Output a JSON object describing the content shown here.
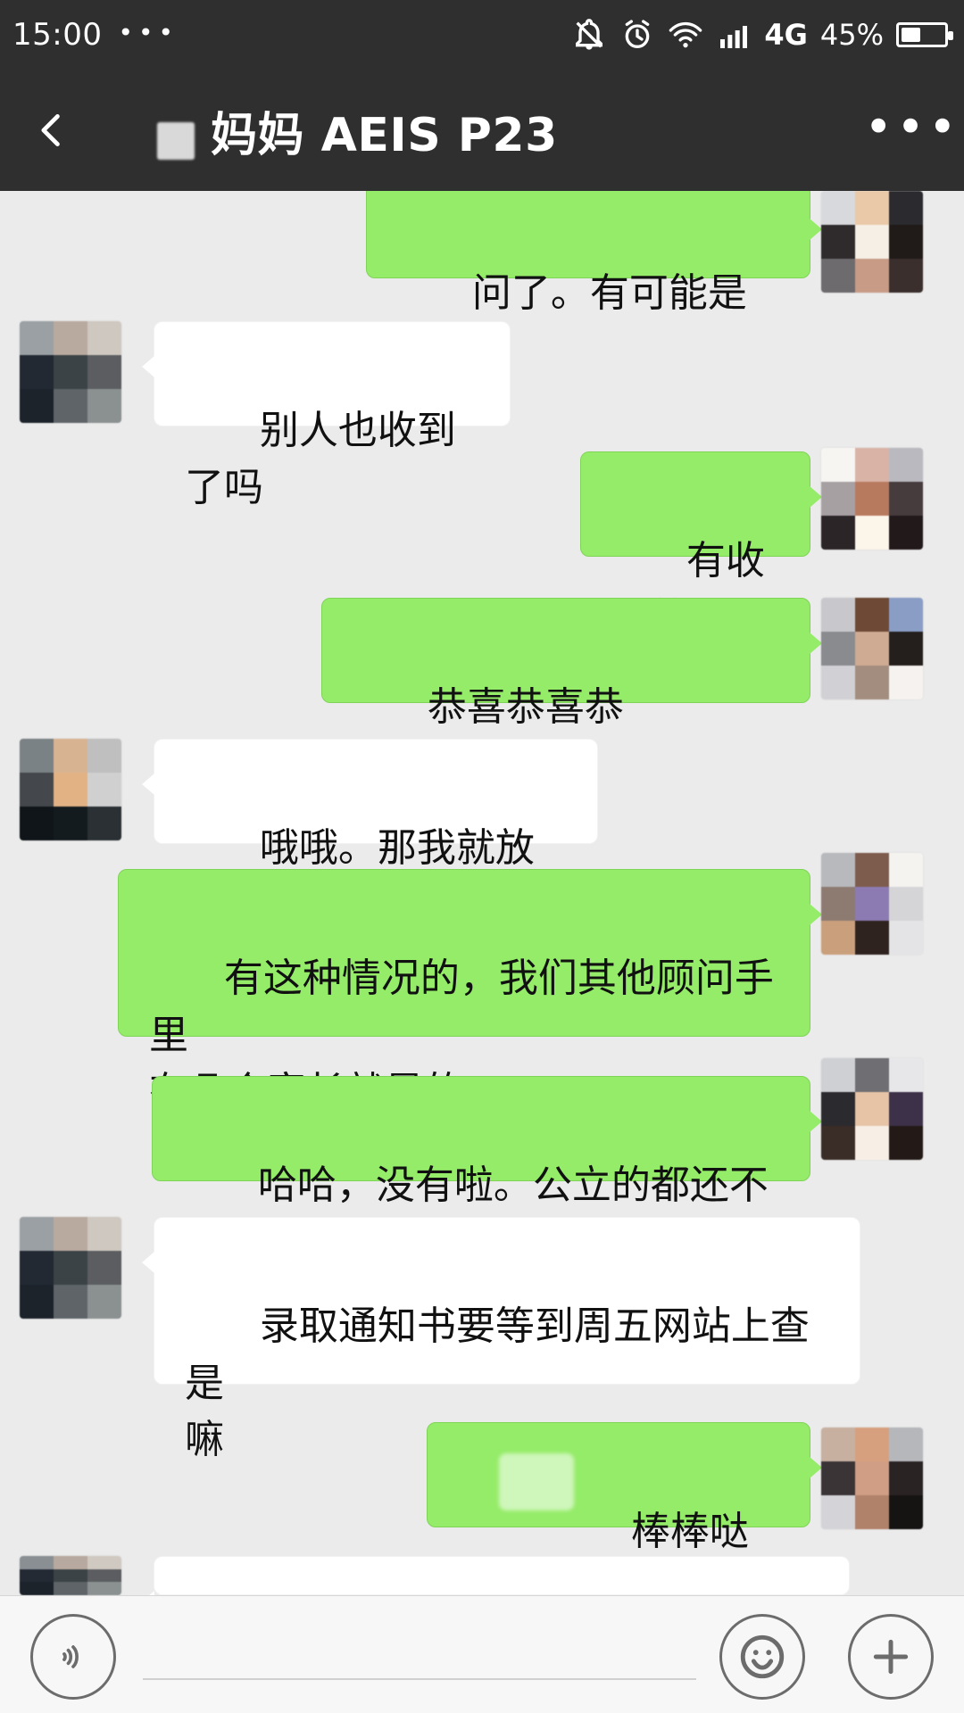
{
  "status_bar": {
    "time": "15:00",
    "dots": "•••",
    "network": "4G",
    "battery_percent": "45%",
    "battery_level": 0.45,
    "icons": [
      "mute-icon",
      "alarm-icon",
      "wifi-icon",
      "signal-icon",
      "battery-icon"
    ]
  },
  "header": {
    "title": "妈妈 AEIS  P23",
    "back_icon": "chevron-left-icon",
    "more_icon": "more-icon"
  },
  "messages": [
    {
      "side": "right",
      "text": "问了。有可能是真的"
    },
    {
      "side": "left",
      "text": "别人也收到了吗"
    },
    {
      "side": "right",
      "text": "有收到的"
    },
    {
      "side": "right",
      "text": "恭喜恭喜恭喜！！！！"
    },
    {
      "side": "left",
      "text": "哦哦。那我就放心了"
    },
    {
      "side": "right",
      "text": "有这种情况的，我们其他顾问手里\n有几个家长就是的"
    },
    {
      "side": "right",
      "text": "哈哈，没有啦。公立的都还不错"
    },
    {
      "side": "left",
      "text": "录取通知书要等到周五网站上查是\n嘛"
    },
    {
      "side": "right",
      "text": "棒棒哒",
      "emoji": [
        "thumbs-up-icon",
        "thumbs-up-icon"
      ]
    }
  ],
  "input_bar": {
    "voice_icon": "voice-icon",
    "emoji_icon": "emoji-icon",
    "plus_icon": "plus-icon"
  }
}
